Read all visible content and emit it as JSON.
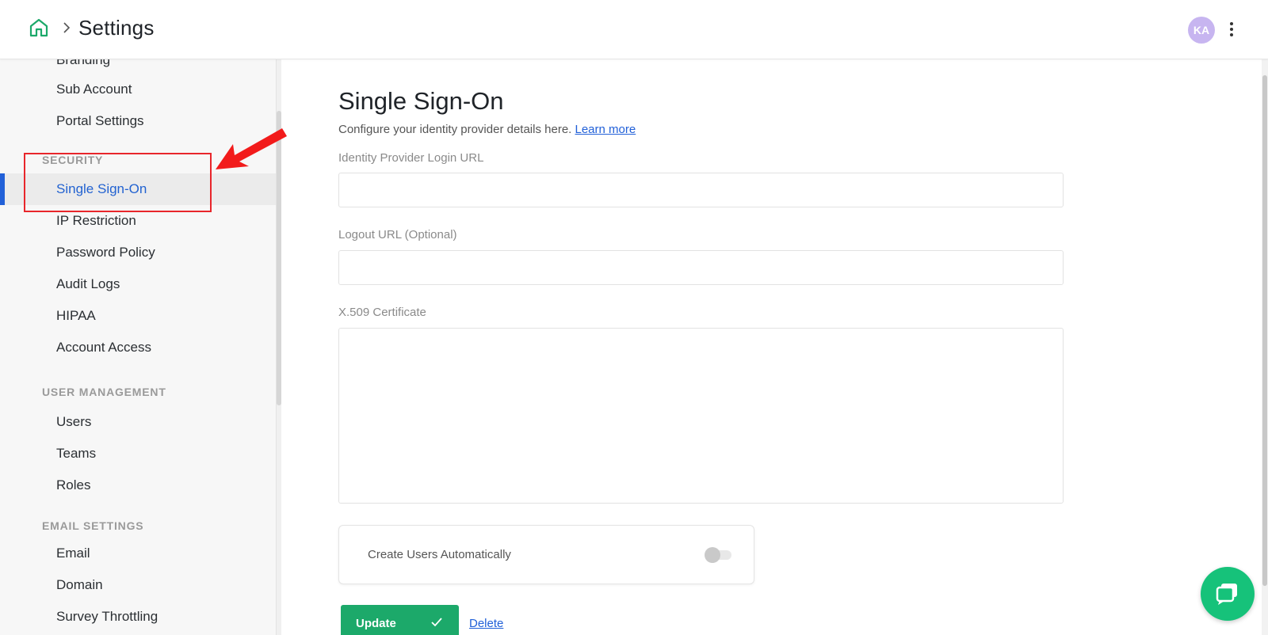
{
  "header": {
    "title": "Settings",
    "avatar_initials": "KA"
  },
  "sidebar": {
    "items_top": [
      {
        "label": "Branding"
      },
      {
        "label": "Sub Account"
      },
      {
        "label": "Portal Settings"
      }
    ],
    "sections": [
      {
        "heading": "SECURITY",
        "items": [
          "Single Sign-On",
          "IP Restriction",
          "Password Policy",
          "Audit Logs",
          "HIPAA",
          "Account Access"
        ]
      },
      {
        "heading": "USER MANAGEMENT",
        "items": [
          "Users",
          "Teams",
          "Roles"
        ]
      },
      {
        "heading": "EMAIL SETTINGS",
        "items": [
          "Email",
          "Domain",
          "Survey Throttling"
        ]
      }
    ],
    "active_item": "Single Sign-On"
  },
  "main": {
    "title": "Single Sign-On",
    "description": "Configure your identity provider details here.",
    "learn_more": "Learn more",
    "fields": {
      "login_url_label": "Identity Provider Login URL",
      "login_url_value": "",
      "logout_url_label": "Logout URL (Optional)",
      "logout_url_value": "",
      "certificate_label": "X.509 Certificate",
      "certificate_value": ""
    },
    "toggle": {
      "label": "Create Users Automatically",
      "enabled": false
    },
    "update_label": "Update",
    "delete_label": "Delete"
  },
  "colors": {
    "accent_blue": "#2160d8",
    "brand_green": "#1ca96a",
    "highlight_red": "#e8262b",
    "avatar": "#c7b5f0"
  },
  "icons": [
    "home-icon",
    "chevron-right-icon",
    "kebab-menu-icon",
    "check-icon",
    "chat-icon"
  ]
}
